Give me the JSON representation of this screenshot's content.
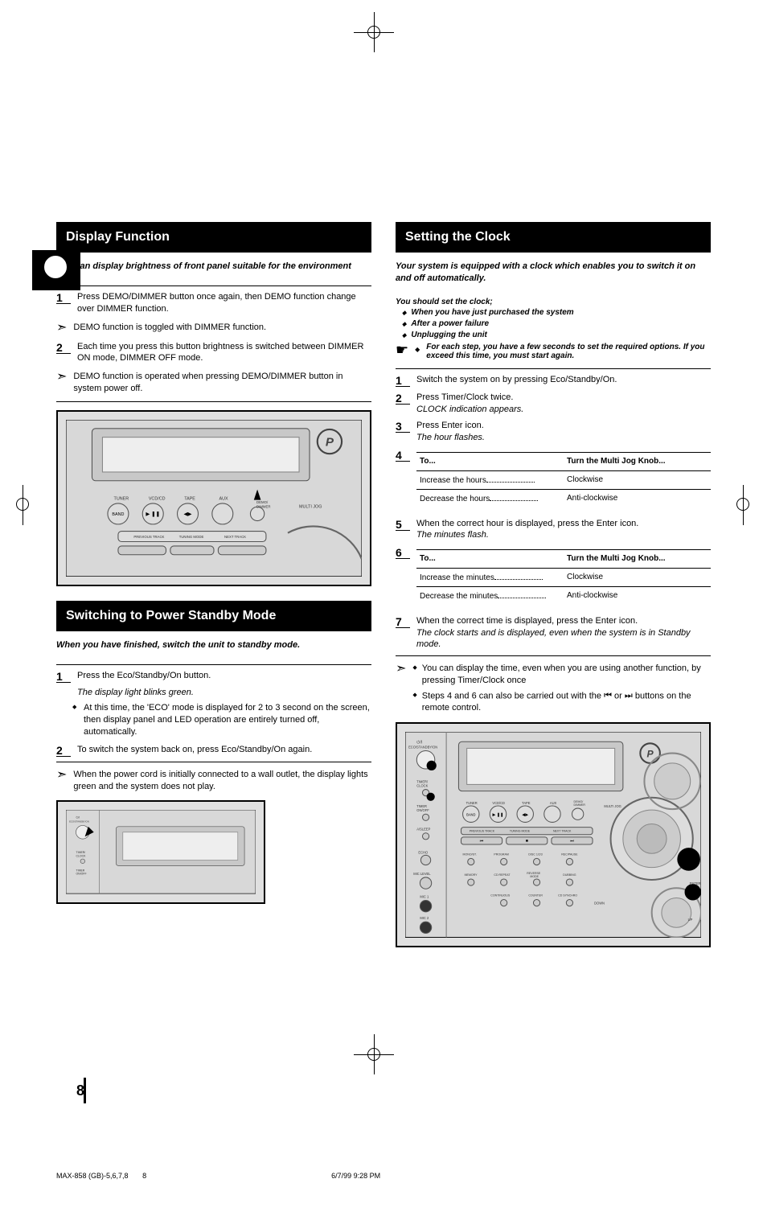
{
  "page_number": "8",
  "footer_file": "MAX-858 (GB)-5,6,7,8",
  "footer_page": "8",
  "footer_datetime": "6/7/99 9:28 PM",
  "left": {
    "section1": {
      "title": "Display Function",
      "intro": "You can display brightness of front panel suitable for the environment",
      "step1_num": "1",
      "step1": "Press DEMO/DIMMER button once again, then DEMO function change over DIMMER function.",
      "note1": "DEMO function is toggled with DIMMER function.",
      "step2_num": "2",
      "step2": "Each time you press this button brightness is switched between DIMMER ON mode, DIMMER OFF mode.",
      "note2": "DEMO function is operated when pressing DEMO/DIMMER button in system power off."
    },
    "section2": {
      "title": "Switching to Power Standby Mode",
      "intro": "When you have finished, switch the unit to standby mode.",
      "step1_num": "1",
      "step1": "Press the Eco/Standby/On button.",
      "result1": "The display light blinks green.",
      "bullet1": "At this time, the 'ECO' mode is displayed for 2 to 3 second on the screen, then display panel and LED operation are entirely turned off, automatically.",
      "step2_num": "2",
      "step2": "To switch the system back on, press Eco/Standby/On again.",
      "note1": "When the power cord is initially connected to a wall outlet, the display lights green and the system does not play."
    }
  },
  "right": {
    "section1": {
      "title": "Setting the Clock",
      "intro": "Your system is equipped with a clock which enables you to switch it on and off automatically.",
      "timing_label": "You should set the clock;",
      "timing": [
        "When you have just purchased the system",
        "After a power failure",
        "Unplugging the unit"
      ],
      "hand_note": "For each step, you have a few seconds to set the required options. If you exceed this time, you must start again.",
      "step1_num": "1",
      "step1": "Switch the system on by pressing Eco/Standby/On.",
      "step2_num": "2",
      "step2": "Press Timer/Clock twice.",
      "step2_result": "CLOCK indication appears.",
      "step3_num": "3",
      "step3": "Press Enter icon.",
      "step3_result": "The hour flashes.",
      "step4_num": "4",
      "step4_intro": "To",
      "step4_table": {
        "head_l": "To...",
        "head_r": "Turn the Multi Jog Knob...",
        "row1_l": "Increase the hours",
        "row1_r": "Clockwise",
        "row2_l": "Decrease the hours",
        "row2_r": "Anti-clockwise"
      },
      "step5_num": "5",
      "step5": "When the correct hour is displayed, press the Enter icon.",
      "step5_result": "The minutes flash.",
      "step6_num": "6",
      "step6_intro": "To",
      "step6_table": {
        "head_l": "To...",
        "head_r": "Turn the Multi Jog Knob...",
        "row1_l": "Increase the minutes",
        "row1_r": "Clockwise",
        "row2_l": "Decrease the minutes",
        "row2_r": "Anti-clockwise"
      },
      "step7_num": "7",
      "step7": "When the correct time is displayed, press the Enter icon.",
      "step7_result": "The clock starts and is displayed, even when the system is in Standby mode.",
      "end_note1": "You can display the time, even when you are using another function, by pressing Timer/Clock once",
      "end_note2": "Steps 4 and 6 can also be carried out with the       or       buttons on the remote control."
    }
  }
}
